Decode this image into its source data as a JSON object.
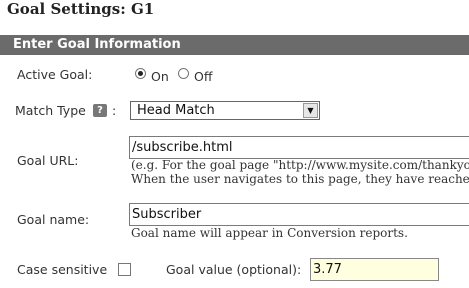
{
  "page": {
    "title": "Goal Settings: G1"
  },
  "section": {
    "title": "Enter Goal Information"
  },
  "active_goal": {
    "label": "Active Goal:",
    "options": [
      "On",
      "Off"
    ],
    "selected": "On"
  },
  "match_type": {
    "label": "Match Type",
    "help_icon": "question-icon",
    "help_glyph": "?",
    "colon": ":",
    "value": "Head Match",
    "arrow_icon": "triangle-down"
  },
  "goal_url": {
    "label": "Goal URL:",
    "value": "/subscribe.html",
    "hint_line1": "(e.g. For the goal page \"http://www.mysite.com/thankyou.h",
    "hint_line2": "When the user navigates to this page, they have reached"
  },
  "goal_name": {
    "label": "Goal name:",
    "value": "Subscriber",
    "hint": "Goal name will appear in Conversion reports."
  },
  "case_sensitive": {
    "label": "Case sensitive",
    "checked": false
  },
  "goal_value": {
    "label": "Goal value (optional):",
    "value": "3.77"
  }
}
